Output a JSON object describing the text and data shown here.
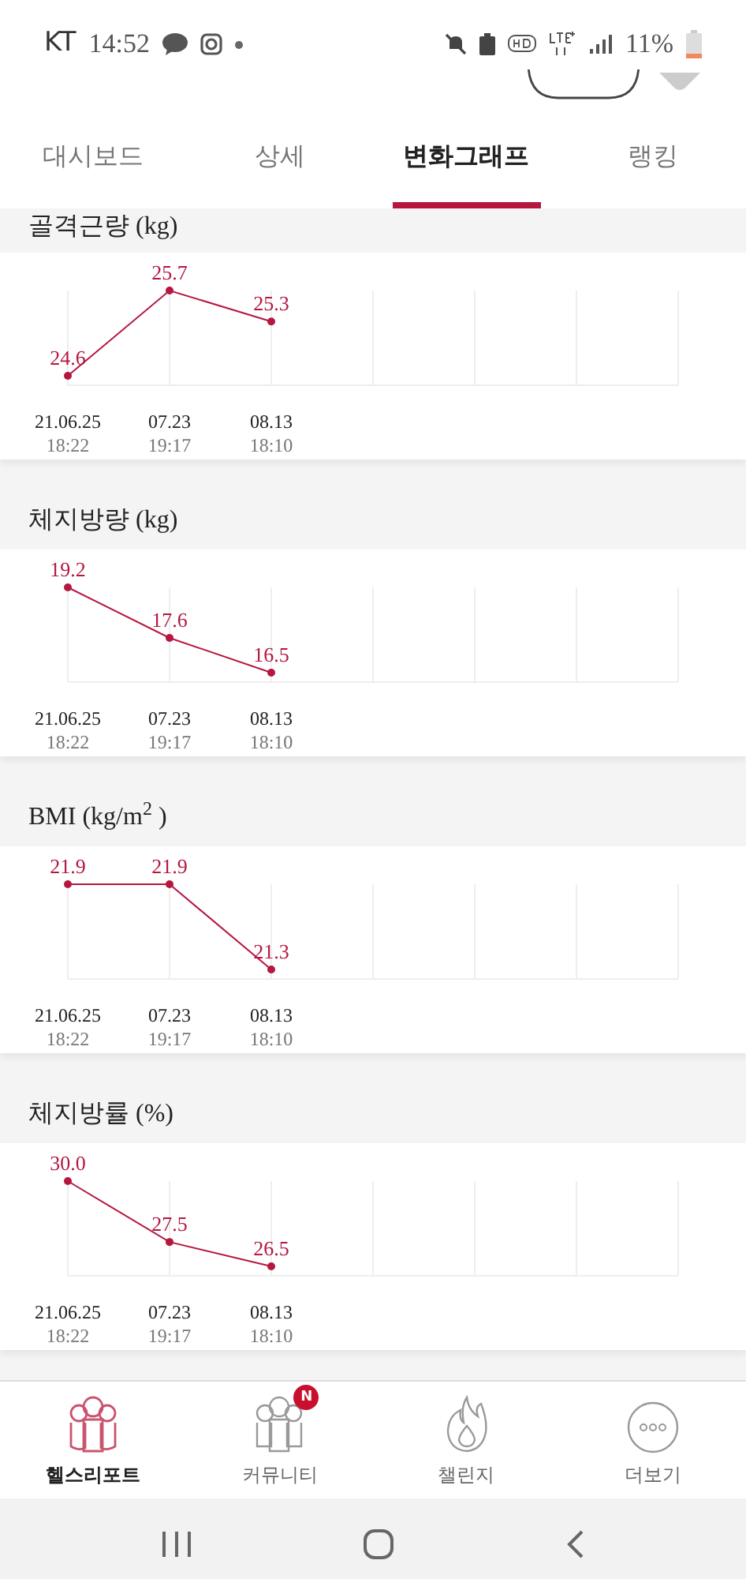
{
  "status_bar": {
    "carrier": "KT",
    "time": "14:52",
    "battery": "11%"
  },
  "tabs": [
    {
      "label": "대시보드",
      "selected": false
    },
    {
      "label": "상세",
      "selected": false
    },
    {
      "label": "변화그래프",
      "selected": true
    },
    {
      "label": "랭킹",
      "selected": false
    }
  ],
  "sections": [
    {
      "times": [
        "18:22",
        "19:17",
        "18:10"
      ],
      "chart_data": {
        "type": "line",
        "title": "골격근량 (kg)",
        "grid": true,
        "categories": [
          "21.06.25",
          "07.23",
          "08.13"
        ],
        "series": [
          {
            "color": "#b5173f",
            "marker": true,
            "values": [
              24.6,
              25.7,
              25.3
            ]
          }
        ],
        "data_labels": true
      }
    },
    {
      "times": [
        "18:22",
        "19:17",
        "18:10"
      ],
      "chart_data": {
        "type": "line",
        "title": "체지방량 (kg)",
        "grid": true,
        "categories": [
          "21.06.25",
          "07.23",
          "08.13"
        ],
        "series": [
          {
            "color": "#b5173f",
            "marker": true,
            "values": [
              19.2,
              17.6,
              16.5
            ]
          }
        ],
        "data_labels": true
      }
    },
    {
      "times": [
        "18:22",
        "19:17",
        "18:10"
      ],
      "chart_data": {
        "type": "line",
        "title": "BMI (kg/m$^{2}$ )",
        "grid": true,
        "categories": [
          "21.06.25",
          "07.23",
          "08.13"
        ],
        "series": [
          {
            "color": "#b5173f",
            "marker": true,
            "values": [
              21.9,
              21.9,
              21.3
            ]
          }
        ],
        "data_labels": true
      }
    },
    {
      "times": [
        "18:22",
        "19:17",
        "18:10"
      ],
      "chart_data": {
        "type": "line",
        "title": "체지방률 (%)",
        "grid": true,
        "categories": [
          "21.06.25",
          "07.23",
          "08.13"
        ],
        "series": [
          {
            "color": "#b5173f",
            "marker": true,
            "values": [
              30.0,
              27.5,
              26.5
            ],
            "value_labels": [
              "30.0",
              "27.5",
              "26.5"
            ]
          }
        ],
        "data_labels": true
      }
    }
  ],
  "bottom_nav": [
    {
      "label": "헬스리포트",
      "selected": true
    },
    {
      "label": "커뮤니티",
      "selected": false,
      "badge": "N"
    },
    {
      "label": "챌린지",
      "selected": false
    },
    {
      "label": "더보기",
      "selected": false
    }
  ]
}
